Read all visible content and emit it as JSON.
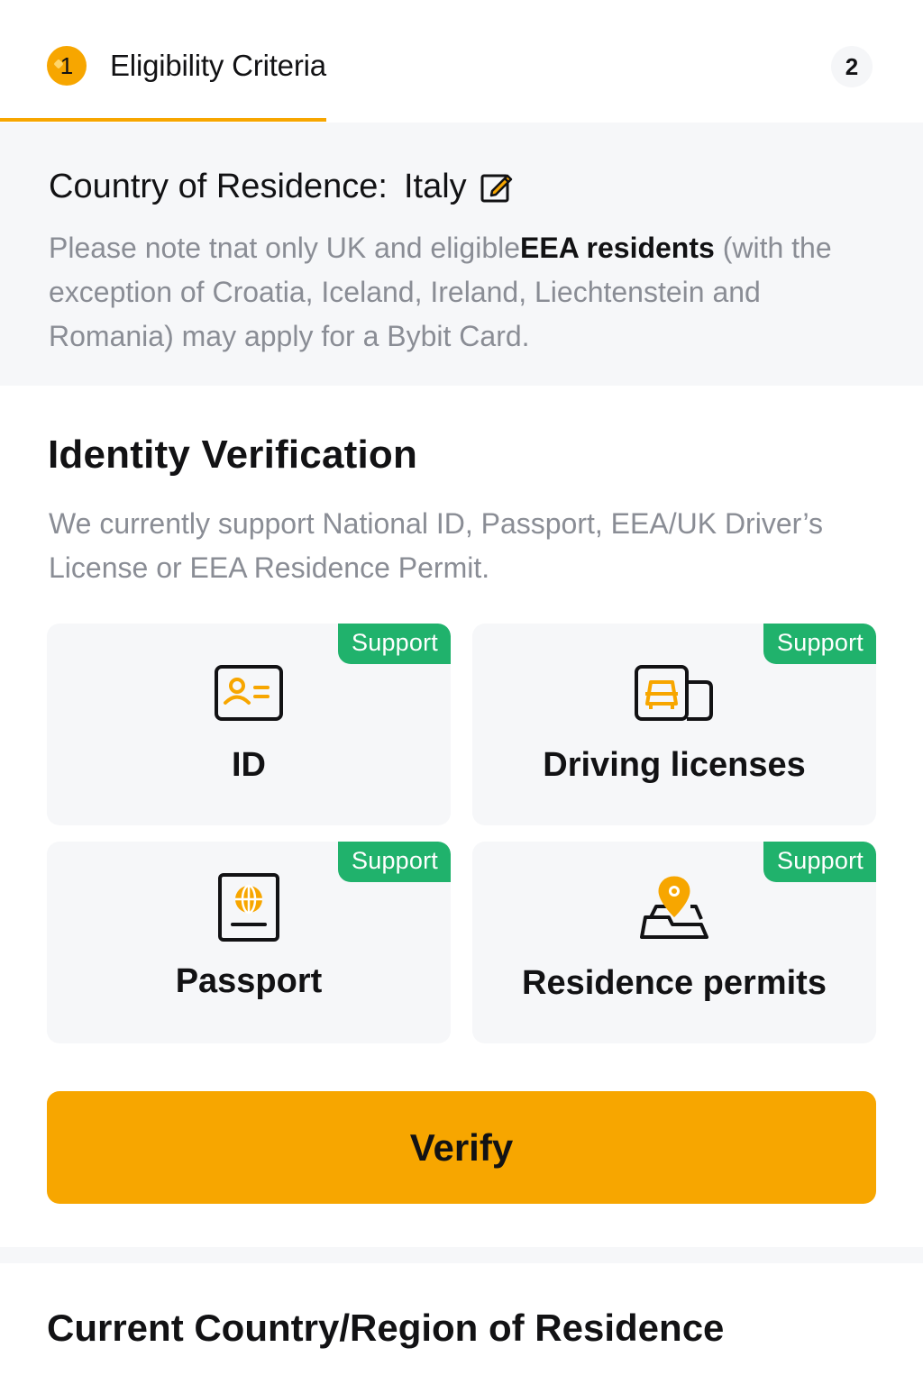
{
  "stepper": {
    "step1_number": "1",
    "step1_label": "Eligibility Criteria",
    "step2_number": "2"
  },
  "country": {
    "label": "Country of Residence:",
    "value": "Italy",
    "note_pre": "Please note tnat only UK and eligible",
    "note_bold": "EEA residents",
    "note_post": " (with the exception of Croatia, Iceland, Ireland, Liechtenstein and Romania) may apply for a Bybit Card."
  },
  "identity": {
    "title": "Identity Verification",
    "description": "We currently support National ID, Passport, EEA/UK Driver’s License or EEA Residence Permit.",
    "documents": [
      {
        "label": "ID",
        "badge": "Support",
        "icon": "id-card-icon"
      },
      {
        "label": "Driving licenses",
        "badge": "Support",
        "icon": "driving-license-icon"
      },
      {
        "label": "Passport",
        "badge": "Support",
        "icon": "passport-icon"
      },
      {
        "label": "Residence permits",
        "badge": "Support",
        "icon": "residence-permit-icon"
      }
    ],
    "verify_label": "Verify"
  },
  "current_country": {
    "title": "Current Country/Region of Residence"
  },
  "colors": {
    "accent": "#f7a600",
    "support_badge": "#20b26c",
    "panel_bg": "#f6f7f9",
    "muted_text": "#8a8d95"
  }
}
